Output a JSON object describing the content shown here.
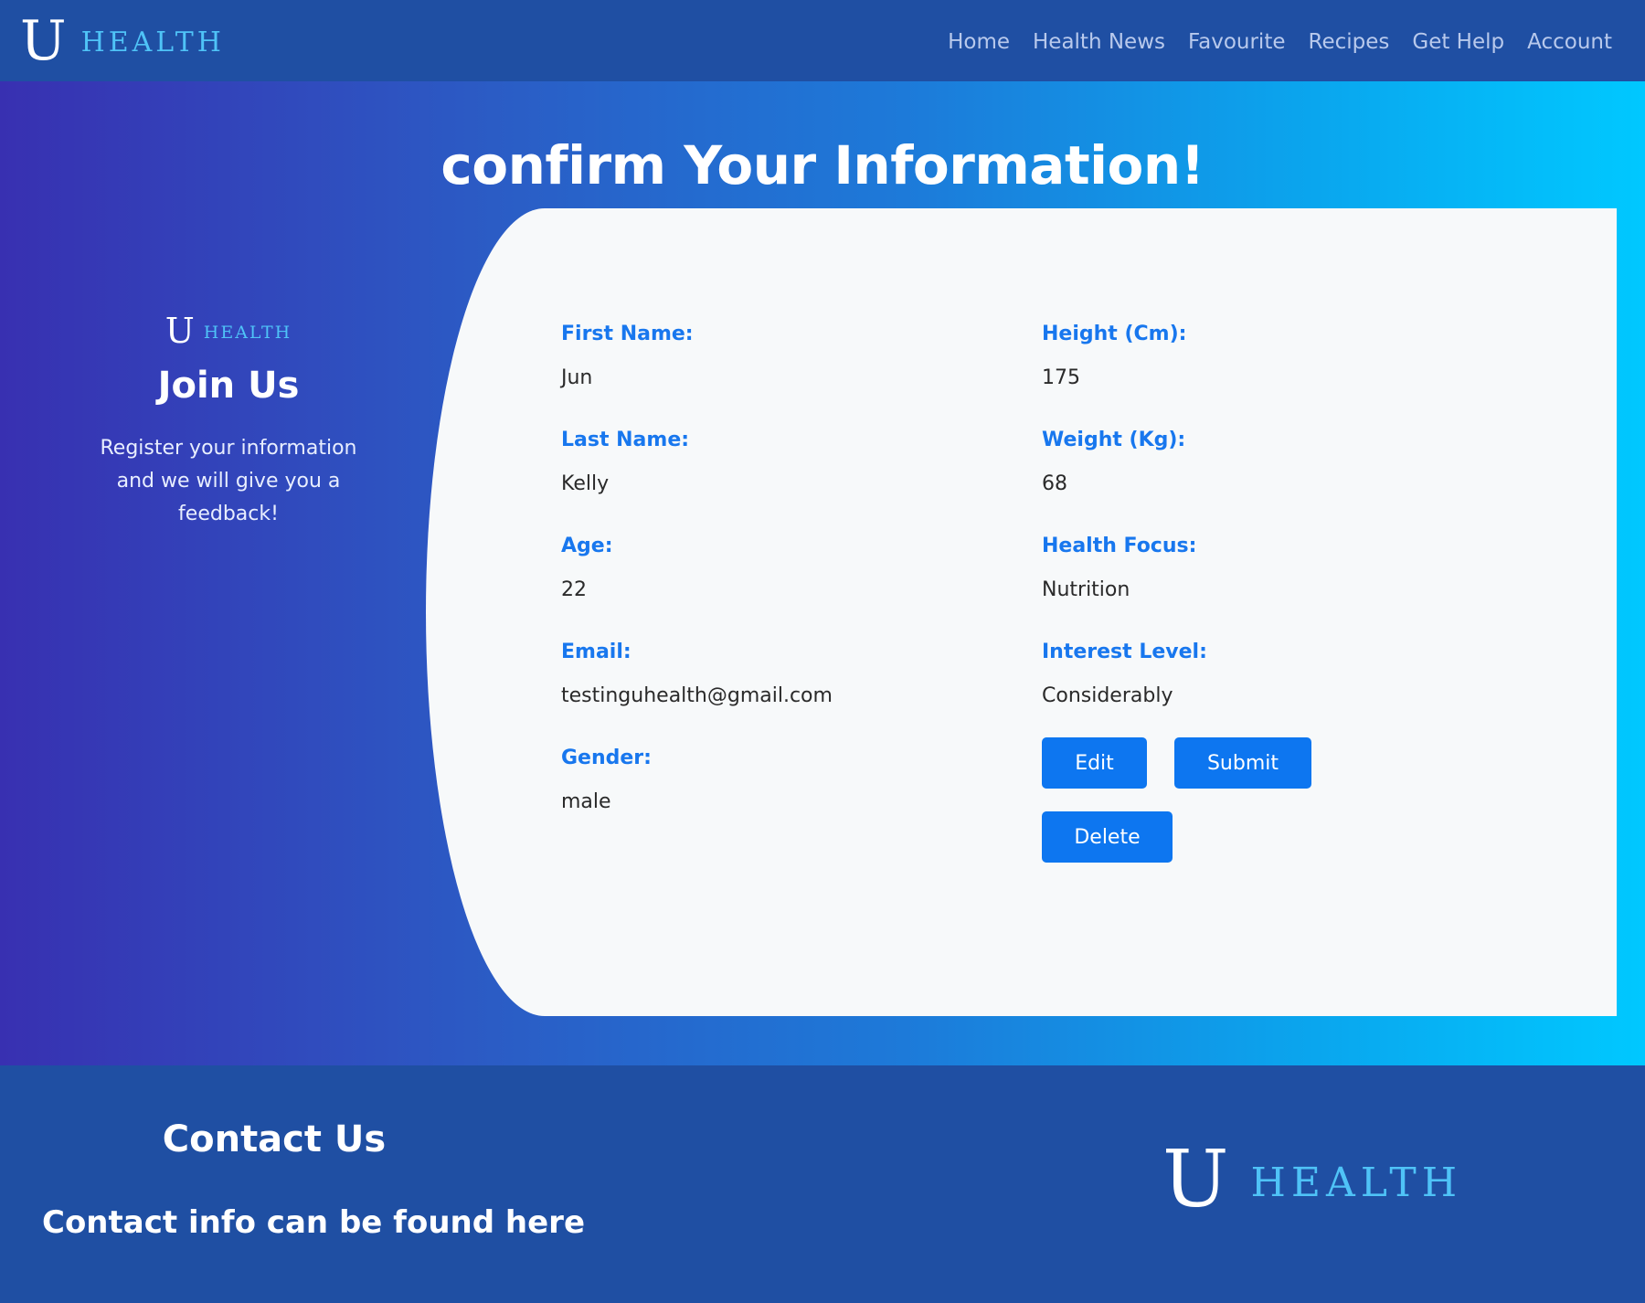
{
  "nav": {
    "brand_u": "U",
    "brand_health": "HEALTH",
    "links": [
      "Home",
      "Health News",
      "Favourite",
      "Recipes",
      "Get Help",
      "Account"
    ]
  },
  "hero": {
    "title": "confirm Your Information!"
  },
  "join": {
    "brand_u": "U",
    "brand_health": "HEALTH",
    "title": "Join Us",
    "text": "Register your information and we will give you a feedback!"
  },
  "form": {
    "left": [
      {
        "label": "First Name:",
        "value": "Jun"
      },
      {
        "label": "Last Name:",
        "value": "Kelly"
      },
      {
        "label": "Age:",
        "value": "22"
      },
      {
        "label": "Email:",
        "value": "testinguhealth@gmail.com"
      },
      {
        "label": "Gender:",
        "value": "male"
      }
    ],
    "right": [
      {
        "label": "Height (Cm):",
        "value": "175"
      },
      {
        "label": "Weight (Kg):",
        "value": "68"
      },
      {
        "label": "Health Focus:",
        "value": "Nutrition"
      },
      {
        "label": "Interest Level:",
        "value": "Considerably"
      }
    ],
    "buttons": {
      "edit": "Edit",
      "submit": "Submit",
      "delete": "Delete"
    }
  },
  "footer": {
    "contact_title": "Contact Us",
    "contact_info": "Contact info can be found here",
    "brand_u": "U",
    "brand_health": "HEALTH"
  },
  "colors": {
    "nav_bg": "#1f4fa3",
    "accent": "#0d76f0",
    "label_blue": "#1877ee",
    "brand_cyan": "#4fc3f7",
    "card_bg": "#f7f9fa"
  }
}
